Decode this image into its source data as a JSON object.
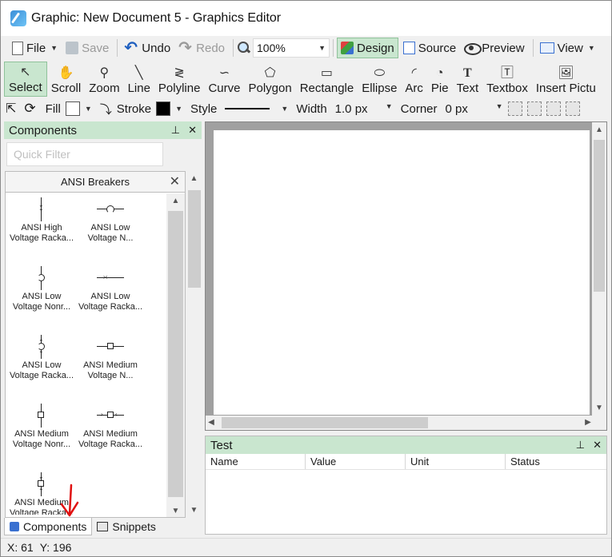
{
  "window": {
    "title": "Graphic: New Document 5 - Graphics Editor"
  },
  "toolbar": {
    "file": "File",
    "save": "Save",
    "undo": "Undo",
    "redo": "Redo",
    "zoom": "100%",
    "design": "Design",
    "source": "Source",
    "preview": "Preview",
    "view": "View"
  },
  "tools": [
    {
      "label": "Select",
      "icon": "pointer-icon",
      "glyph": "↖"
    },
    {
      "label": "Scroll",
      "icon": "hand-icon",
      "glyph": "✋"
    },
    {
      "label": "Zoom",
      "icon": "zoom-icon",
      "glyph": "⚲"
    },
    {
      "label": "Line",
      "icon": "line-icon",
      "glyph": "╲"
    },
    {
      "label": "Polyline",
      "icon": "polyline-icon",
      "glyph": "≷"
    },
    {
      "label": "Curve",
      "icon": "curve-icon",
      "glyph": "∽"
    },
    {
      "label": "Polygon",
      "icon": "polygon-icon",
      "glyph": "⬠"
    },
    {
      "label": "Rectangle",
      "icon": "rectangle-icon",
      "glyph": "▭"
    },
    {
      "label": "Ellipse",
      "icon": "ellipse-icon",
      "glyph": "⬭"
    },
    {
      "label": "Arc",
      "icon": "arc-icon",
      "glyph": "◜"
    },
    {
      "label": "Pie",
      "icon": "pie-icon",
      "glyph": "◔"
    },
    {
      "label": "Text",
      "icon": "text-icon",
      "glyph": "T"
    },
    {
      "label": "Textbox",
      "icon": "textbox-icon",
      "glyph": "🅃"
    },
    {
      "label": "Insert Pictu",
      "icon": "picture-icon",
      "glyph": "🖼"
    }
  ],
  "properties": {
    "fill": "Fill",
    "fill_color": "#ffffff",
    "stroke": "Stroke",
    "stroke_color": "#000000",
    "style": "Style",
    "width": "Width",
    "width_value": "1.0 px",
    "corner": "Corner",
    "corner_value": "0 px"
  },
  "components": {
    "title": "Components",
    "filter_placeholder": "Quick Filter",
    "group": "ANSI Breakers",
    "items": [
      [
        "ANSI High",
        "Voltage Racka..."
      ],
      [
        "ANSI Low",
        "Voltage N..."
      ],
      [
        "ANSI Low",
        "Voltage Nonr..."
      ],
      [
        "ANSI Low",
        "Voltage Racka..."
      ],
      [
        "ANSI Low",
        "Voltage Racka..."
      ],
      [
        "ANSI Medium",
        "Voltage N..."
      ],
      [
        "ANSI Medium",
        "Voltage Nonr..."
      ],
      [
        "ANSI Medium",
        "Voltage Racka..."
      ],
      [
        "ANSI Medium",
        "Voltage Racka..."
      ]
    ],
    "tabs": [
      "Components",
      "Snippets"
    ]
  },
  "test": {
    "title": "Test",
    "columns": [
      "Name",
      "Value",
      "Unit",
      "Status"
    ]
  },
  "status": {
    "x": "X: 61",
    "y": "Y: 196"
  },
  "colors": {
    "accent": "#c9e6cf",
    "annotation_arrow": "#e01010"
  }
}
